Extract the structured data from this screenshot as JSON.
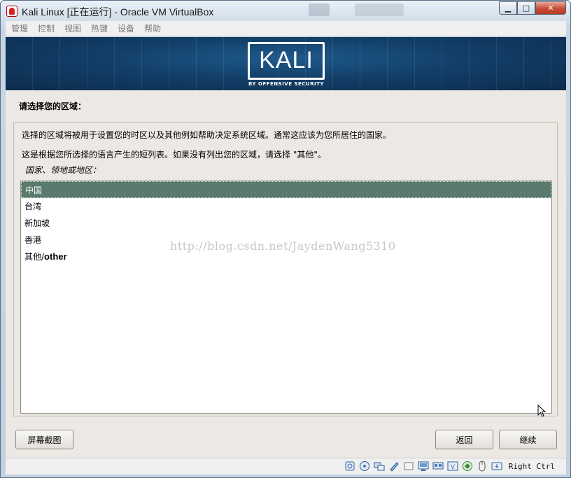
{
  "window": {
    "title": "Kali Linux [正在运行] - Oracle VM VirtualBox",
    "minimize_glyph": "▁",
    "maximize_glyph": "□",
    "close_glyph": "✕"
  },
  "menu": {
    "items": [
      "管理",
      "控制",
      "视图",
      "热键",
      "设备",
      "帮助"
    ]
  },
  "banner": {
    "logo": "KALI",
    "subtitle": "BY OFFENSIVE SECURITY"
  },
  "installer": {
    "section_title": "请选择您的区域：",
    "description_1": "选择的区域将被用于设置您的时区以及其他例如帮助决定系统区域。通常这应该为您所居住的国家。",
    "description_2": "这是根据您所选择的语言产生的短列表。如果没有列出您的区域，请选择 \"其他\"。",
    "list_label": "国家、领地或地区：",
    "options": [
      {
        "label": "中国",
        "latin": "",
        "selected": true
      },
      {
        "label": "台湾",
        "latin": "",
        "selected": false
      },
      {
        "label": "新加坡",
        "latin": "",
        "selected": false
      },
      {
        "label": "香港",
        "latin": "",
        "selected": false
      },
      {
        "label": "其他/",
        "latin": "other",
        "selected": false
      }
    ],
    "watermark": "http://blog.csdn.net/JaydenWang5310",
    "buttons": {
      "screenshot": "屏幕截图",
      "back": "返回",
      "continue": "继续"
    }
  },
  "statusbar": {
    "icons": [
      "hard-disk-icon",
      "optical-drive-icon",
      "audio-icon",
      "network-icon",
      "usb-icon",
      "shared-folders-icon",
      "display-icon",
      "video-capture-icon",
      "virtualization-icon",
      "mouse-integration-icon",
      "keyboard-capture-icon"
    ],
    "host_key": "Right Ctrl"
  },
  "colors": {
    "selection": "#5a7a6e",
    "banner": "#123f68",
    "close_button": "#c74c35"
  }
}
